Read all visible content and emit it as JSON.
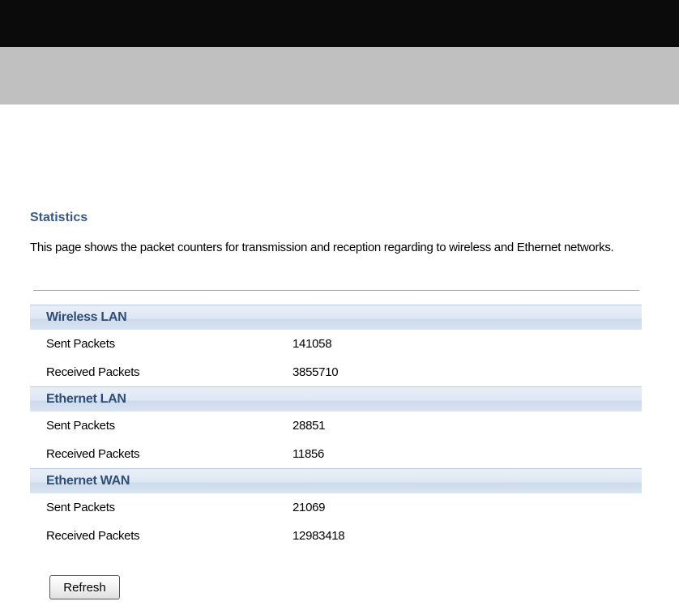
{
  "page": {
    "title": "Statistics",
    "description": "This page shows the packet counters for transmission and reception regarding to wireless and Ethernet networks."
  },
  "sections": [
    {
      "title": "Wireless LAN",
      "rows": [
        {
          "label": "Sent Packets",
          "value": "141058"
        },
        {
          "label": "Received Packets",
          "value": "3855710"
        }
      ]
    },
    {
      "title": "Ethernet LAN",
      "rows": [
        {
          "label": "Sent Packets",
          "value": "28851"
        },
        {
          "label": "Received Packets",
          "value": "11856"
        }
      ]
    },
    {
      "title": "Ethernet WAN",
      "rows": [
        {
          "label": "Sent Packets",
          "value": "21069"
        },
        {
          "label": "Received Packets",
          "value": "12983418"
        }
      ]
    }
  ],
  "actions": {
    "refresh_label": "Refresh"
  },
  "colors": {
    "top_bar": "#0b0b0b",
    "sub_bar": "#c0c0c0",
    "title": "#3a5a86",
    "section_header_text": "#2f4e77"
  }
}
